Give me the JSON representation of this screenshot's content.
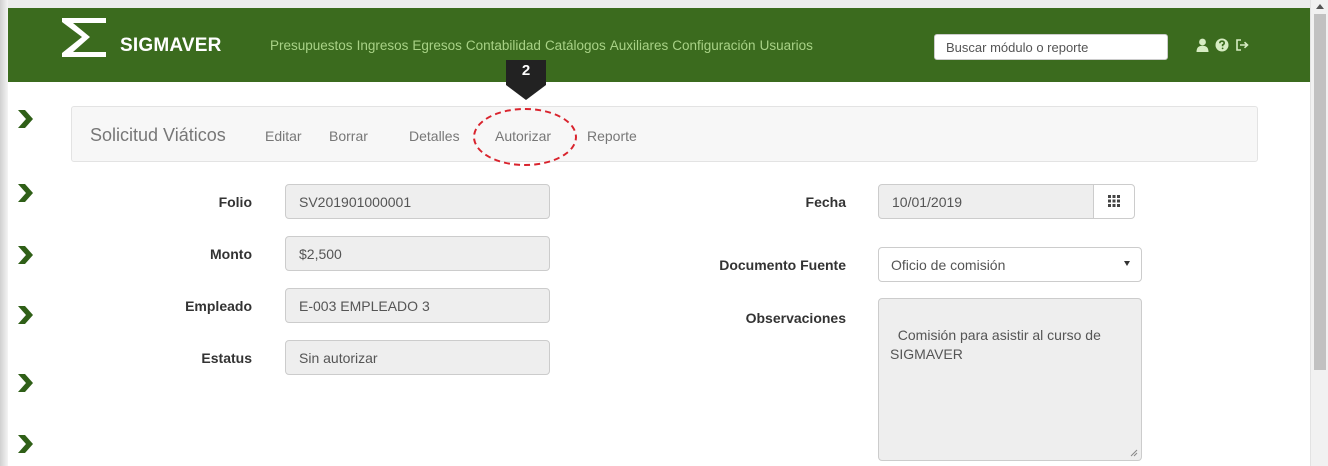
{
  "app": {
    "brand": "SIGMAVER",
    "accent_color": "#3b6b1e",
    "menu_text_color": "#a8d286",
    "highlight_color": "#d9232d"
  },
  "nav": {
    "items": [
      "Presupuestos",
      "Ingresos",
      "Egresos",
      "Contabilidad",
      "Catálogos",
      "Auxiliares",
      "Configuración",
      "Usuarios"
    ],
    "search_placeholder": "Buscar módulo o reporte",
    "icons": [
      "user-icon",
      "help-icon",
      "logout-icon"
    ]
  },
  "step_marker": "2",
  "panel": {
    "title": "Solicitud Viáticos",
    "actions": [
      "Editar",
      "Borrar",
      "Detalles",
      "Autorizar",
      "Reporte"
    ],
    "highlighted_action": "Autorizar"
  },
  "form": {
    "folio": {
      "label": "Folio",
      "value": "SV201901000001"
    },
    "monto": {
      "label": "Monto",
      "value": "$2,500"
    },
    "empleado": {
      "label": "Empleado",
      "value": "E-003 EMPLEADO 3"
    },
    "estatus": {
      "label": "Estatus",
      "value": "Sin autorizar"
    },
    "fecha": {
      "label": "Fecha",
      "value": "10/01/2019"
    },
    "documento_fuente": {
      "label": "Documento Fuente",
      "value": "Oficio de comisión"
    },
    "observaciones": {
      "label": "Observaciones",
      "value": "Comisión para asistir al curso de SIGMAVER"
    }
  }
}
